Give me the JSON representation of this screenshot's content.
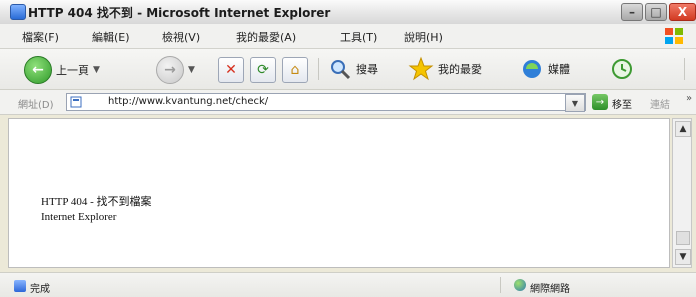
{
  "window": {
    "title": "HTTP 404 找不到 - Microsoft Internet Explorer",
    "minimize_label": "–",
    "maximize_label": "□",
    "close_label": "X"
  },
  "menu": {
    "items": [
      "檔案(F)",
      "編輯(E)",
      "檢視(V)",
      "我的最愛(A)",
      "工具(T)",
      "說明(H)"
    ]
  },
  "toolbar": {
    "back_label": "上一頁",
    "search_label": "搜尋",
    "favorites_label": "我的最愛",
    "media_label": "媒體"
  },
  "address": {
    "label": "網址(D)",
    "url": "http://www.kvantung.net/check/",
    "go_label": "移至",
    "links_label": "連結"
  },
  "page": {
    "heading": "HTTP 404 - 找不到檔案",
    "subheading": "Internet Explorer"
  },
  "status": {
    "left": "完成",
    "zone": "網際網路"
  }
}
